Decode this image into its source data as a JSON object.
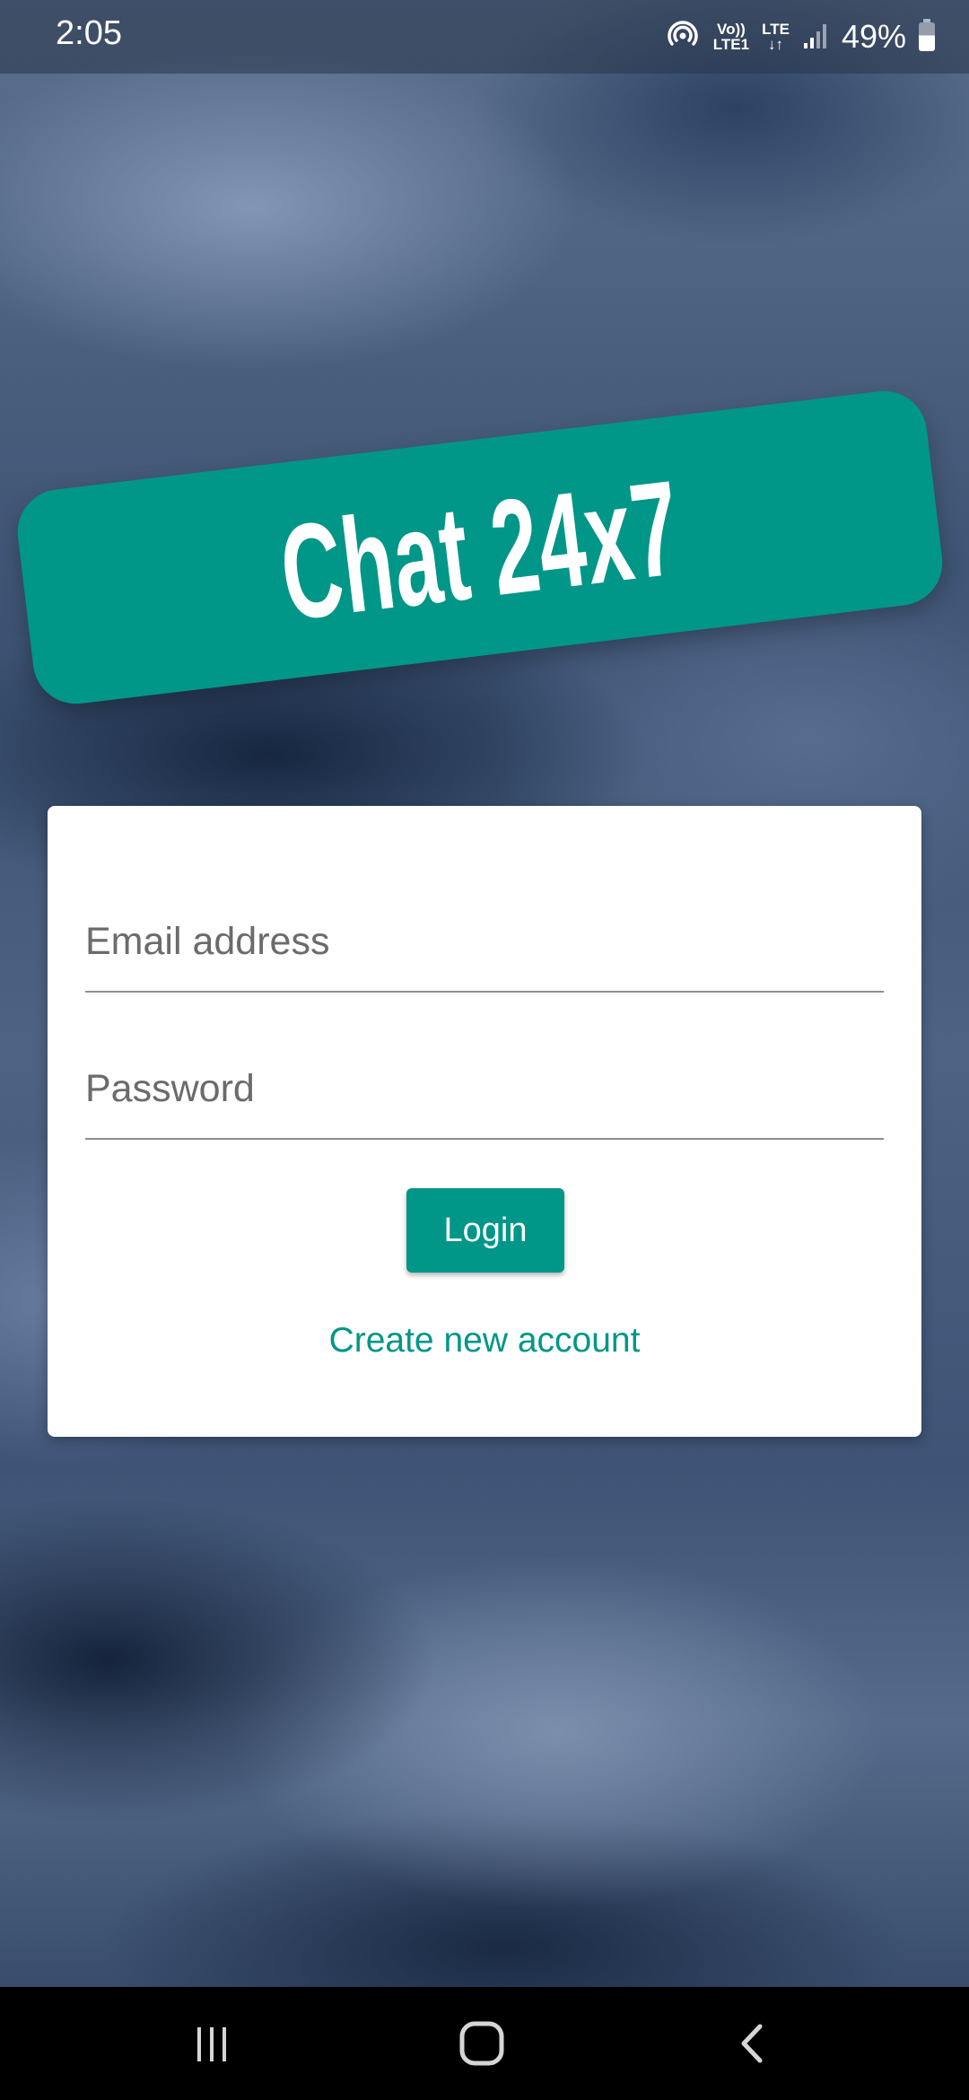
{
  "status_bar": {
    "time": "2:05",
    "network_top": "Vo))",
    "network_bottom": "LTE1",
    "lte_top": "LTE",
    "lte_bottom": "↓↑",
    "battery": "49%",
    "icons": [
      "hotspot-icon",
      "volte-icon",
      "lte-data-icon",
      "signal-icon",
      "battery-icon"
    ]
  },
  "logo": {
    "text": "Chat 24x7",
    "color": "#009688"
  },
  "form": {
    "email_placeholder": "Email address",
    "password_placeholder": "Password",
    "login_label": "Login",
    "create_account_label": "Create new account"
  },
  "nav_bar": {
    "buttons": [
      "recents-icon",
      "home-icon",
      "back-icon"
    ]
  },
  "colors": {
    "accent": "#009688",
    "card": "#ffffff",
    "nav_bar": "#000000"
  }
}
